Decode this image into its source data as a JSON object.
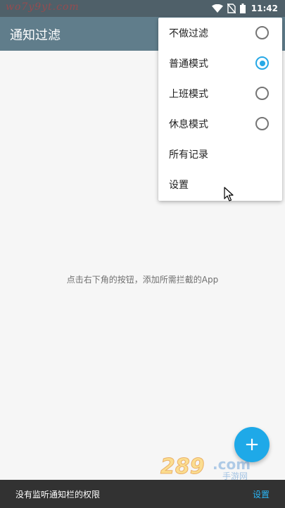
{
  "status_bar": {
    "time": "11:42",
    "icons": [
      "wifi-icon",
      "no-sim-icon",
      "battery-icon"
    ]
  },
  "watermark_top": "wo7y9yt.com",
  "app_bar": {
    "title": "通知过滤"
  },
  "main": {
    "empty_text": "点击右下角的按钮，添加所需拦截的App"
  },
  "menu": {
    "items": [
      {
        "label": "不做过滤",
        "radio": true,
        "checked": false
      },
      {
        "label": "普通模式",
        "radio": true,
        "checked": true
      },
      {
        "label": "上班模式",
        "radio": true,
        "checked": false
      },
      {
        "label": "休息模式",
        "radio": true,
        "checked": false
      },
      {
        "label": "所有记录",
        "radio": false
      },
      {
        "label": "设置",
        "radio": false
      }
    ]
  },
  "fab": {
    "icon": "plus-icon",
    "symbol": "+"
  },
  "snackbar": {
    "message": "没有监听通知栏的权限",
    "action": "设置"
  },
  "watermark_logo": {
    "text": "289.com",
    "subtext": "手游网"
  },
  "colors": {
    "app_bar": "#607d8b",
    "status_bar": "#4f6069",
    "accent": "#26a8e6",
    "fab": "#1ea9e8",
    "snackbar": "#323232",
    "snackbar_action": "#29b6f6"
  }
}
